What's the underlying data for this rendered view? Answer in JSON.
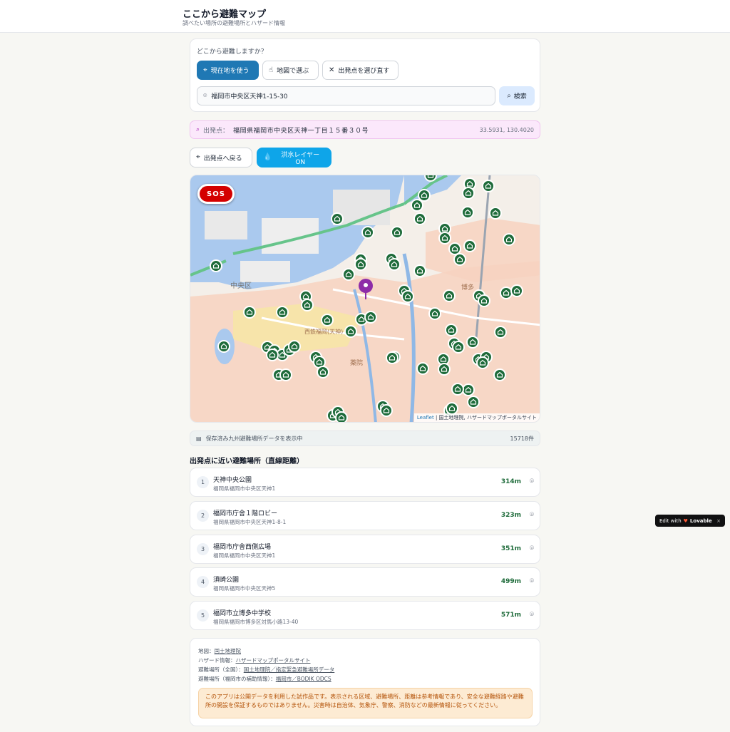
{
  "header": {
    "title": "ここから避難マップ",
    "subtitle": "調べたい場所の避難場所とハザード情報"
  },
  "search": {
    "question": "どこから避難しますか？",
    "use_location_label": "現在地を使う",
    "pick_on_map_label": "地図で選ぶ",
    "reset_origin_label": "出発点を選び直す",
    "address_value": "福岡市中央区天神1-15-30",
    "search_label": "検索"
  },
  "origin": {
    "label": "出発点：",
    "address": "福岡県福岡市中央区天神一丁目１５番３０号",
    "coords": "33.5931, 130.4020"
  },
  "controls": {
    "back_to_origin_label": "出発点へ戻る",
    "flood_layer_label": "洪水レイヤー ON"
  },
  "map": {
    "sos_label": "SOS",
    "attribution_leaflet": "Leaflet",
    "attribution_rest": "| 国土地理院, ハザードマップポータルサイト",
    "place_labels": [
      "中央区",
      "西鉄福岡(天神)",
      "薬院",
      "博多"
    ],
    "colors": {
      "water": "#aac9ee",
      "flood": "#f7d2bf",
      "land": "#f4efe9",
      "marker": "#1e6b3a",
      "origin_marker": "#8e2ca8"
    }
  },
  "info": {
    "text": "保存済み九州避難場所データを表示中",
    "count": "15718件"
  },
  "nearby": {
    "title": "出発点に近い避難場所（直線距離）",
    "items": [
      {
        "num": "1",
        "name": "天神中央公園",
        "address": "福岡県福岡市中央区天神1",
        "distance": "314m"
      },
      {
        "num": "2",
        "name": "福岡市庁舎１階ロビー",
        "address": "福岡県福岡市中央区天神1-8-1",
        "distance": "323m"
      },
      {
        "num": "3",
        "name": "福岡市庁舎西側広場",
        "address": "福岡県福岡市中央区天神1",
        "distance": "351m"
      },
      {
        "num": "4",
        "name": "須崎公園",
        "address": "福岡県福岡市中央区天神5",
        "distance": "499m"
      },
      {
        "num": "5",
        "name": "福岡市立博多中学校",
        "address": "福岡県福岡市博多区対馬小路13-40",
        "distance": "571m"
      }
    ]
  },
  "footer": {
    "map_label": "地図：",
    "map_link": "国土地理院",
    "hazard_label": "ハザード情報：",
    "hazard_link": "ハザードマップポータルサイト",
    "shelter_all_label": "避難場所（全国）：",
    "shelter_all_link": "国土地理院／指定緊急避難場所データ",
    "shelter_fukuoka_label": "避難場所（福岡市の補助情報）：",
    "shelter_fukuoka_link": "福岡市／BODIK ODCS",
    "notice": "このアプリは公開データを利用した試作品です。表示される区域、避難場所、距離は参考情報であり、安全な避難経路や避難所の開設を保証するものではありません。災害時は自治体、気象庁、警察、消防などの最新情報に従ってください。"
  },
  "badge": {
    "prefix": "Edit with",
    "brand": "Lovable",
    "close": "×"
  }
}
